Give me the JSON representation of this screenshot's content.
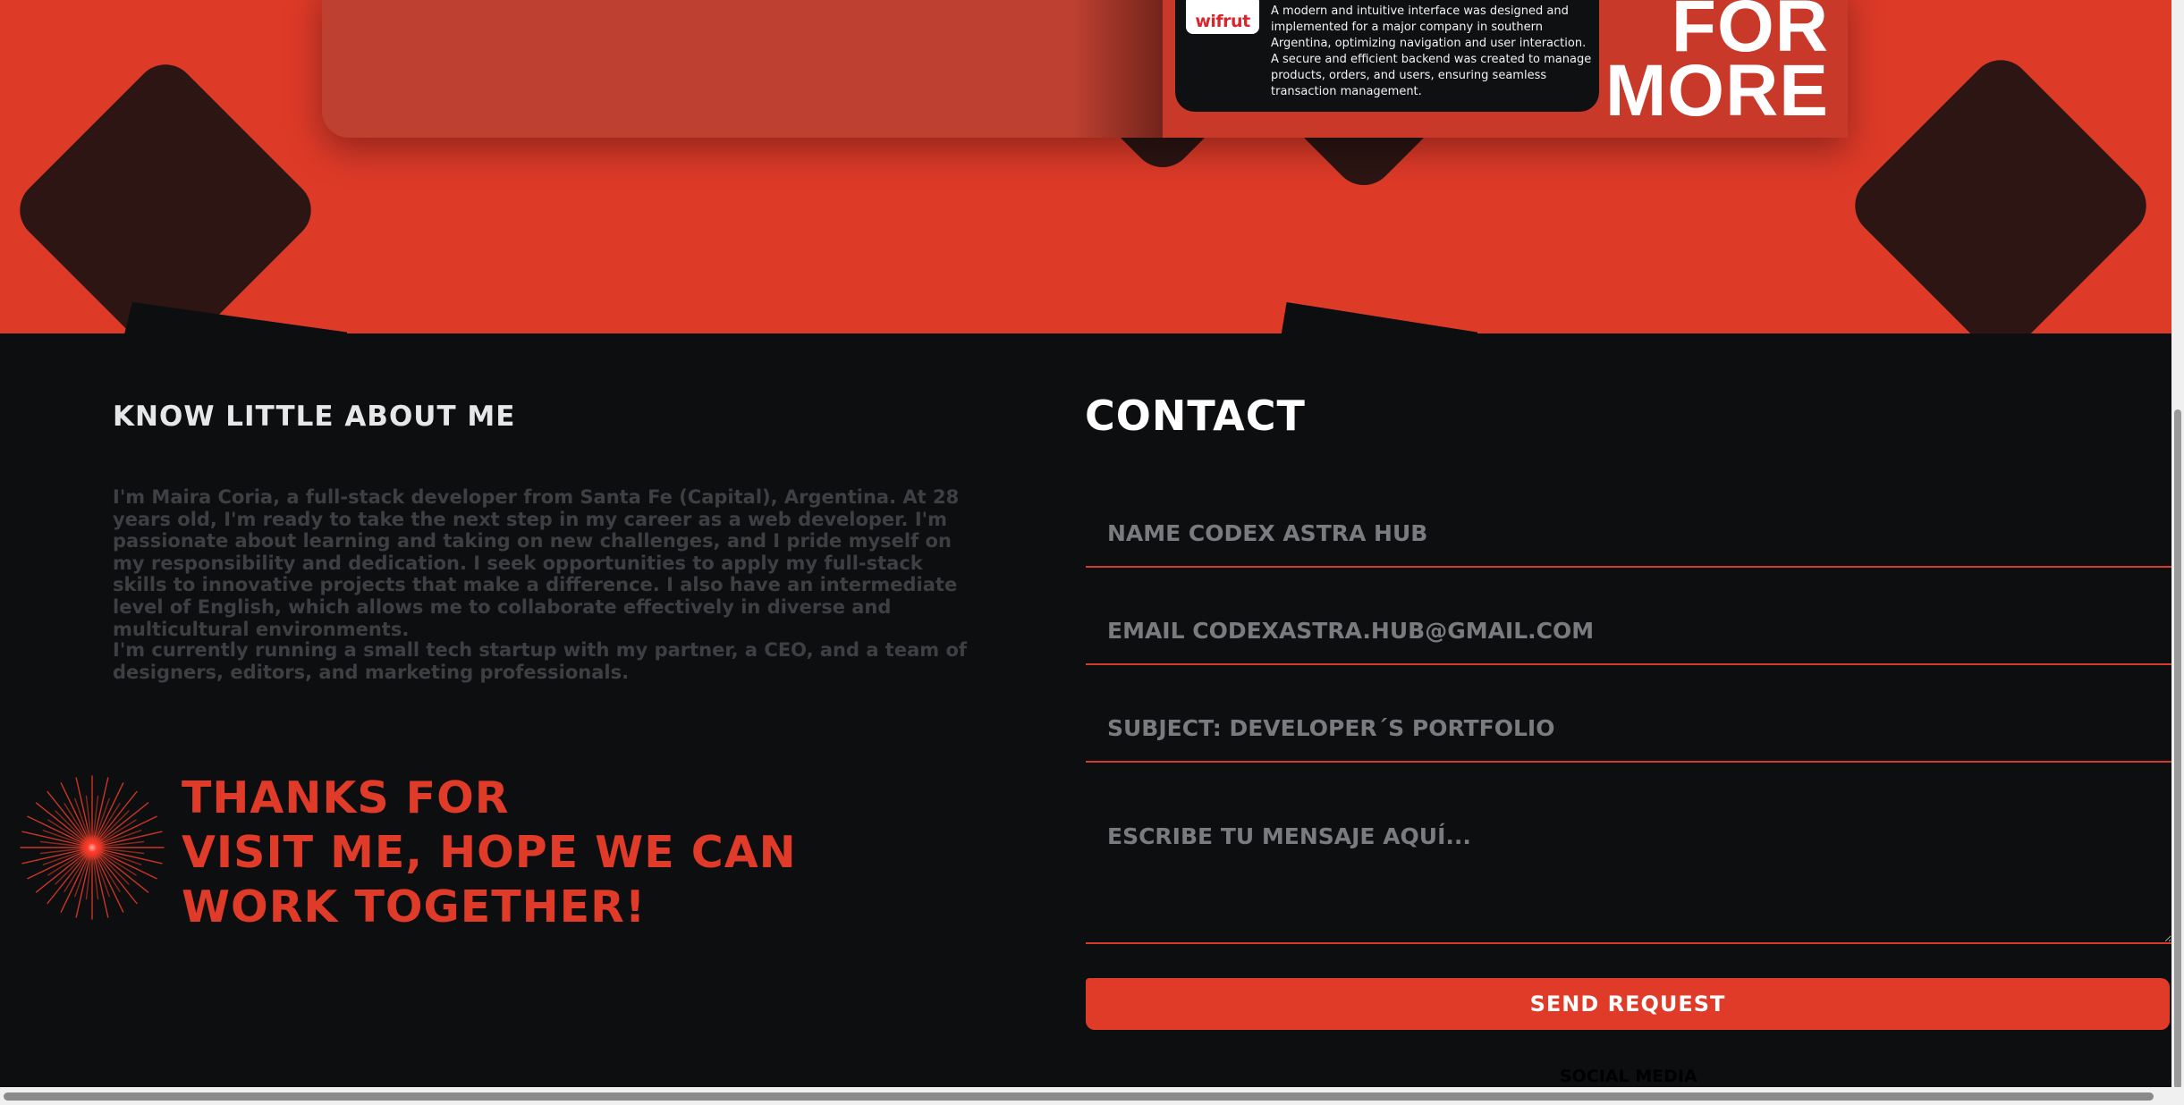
{
  "colors": {
    "accent": "#de3a28",
    "dark_background": "#0d0e10",
    "diamond": "#2c1513",
    "muted_text": "#3e3f43"
  },
  "project": {
    "logo_text": "wifrut",
    "description": "A modern and intuitive interface was designed and implemented for a major company in southern Argentina, optimizing navigation and user interaction. A secure and efficient backend was created to manage products, orders, and users, ensuring seamless transaction management.",
    "more_line1": "FOR",
    "more_line2": "MORE"
  },
  "about": {
    "title": "KNOW LITTLE ABOUT ME",
    "paragraph1": "I'm Maira Coria, a full-stack developer from Santa Fe (Capital), Argentina. At 28 years old, I'm ready to take the next step in my career as a web developer. I'm passionate about learning and taking on new challenges, and I pride myself on my responsibility and dedication. I seek opportunities to apply my full-stack skills to innovative projects that make a difference. I also have an intermediate level of English, which allows me to collaborate effectively in diverse and multicultural environments.",
    "paragraph2": "I'm currently running a small tech startup with my partner, a CEO, and a team of designers, editors, and marketing professionals.",
    "thanks_line1": "THANKS FOR",
    "thanks_line2": "VISIT ME, HOPE WE CAN",
    "thanks_line3": "WORK TOGETHER!"
  },
  "contact": {
    "title": "CONTACT",
    "name_placeholder": "NAME CODEX ASTRA HUB",
    "email_placeholder": "EMAIL CODEXASTRA.HUB@GMAIL.COM",
    "subject_placeholder": "SUBJECT: DEVELOPER´S PORTFOLIO",
    "message_placeholder": "ESCRIBE TU MENSAJE AQUÍ...",
    "send_label": "SEND REQUEST",
    "social_label": "SOCIAL MEDIA"
  }
}
